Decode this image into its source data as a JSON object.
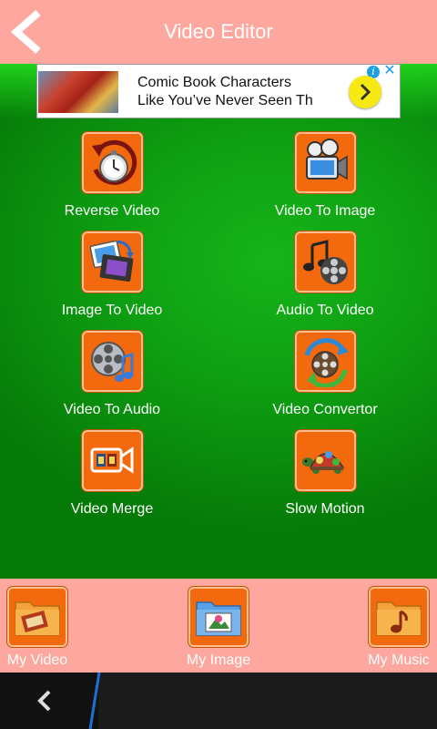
{
  "header": {
    "title": "Video Editor",
    "back_icon": "chevron-left-icon",
    "background": "#fda79f"
  },
  "ad": {
    "text": "Comic Book Characters\nLike You’ve Never Seen Th",
    "info_icon": "info-icon",
    "info_glyph": "i",
    "close_icon": "close-icon",
    "close_glyph": "✕",
    "arrow_icon": "chevron-right-icon"
  },
  "tools": [
    {
      "label": "Reverse Video",
      "icon": "stopwatch-icon"
    },
    {
      "label": "Video To Image",
      "icon": "film-projector-icon"
    },
    {
      "label": "Image To Video",
      "icon": "image-to-video-icon"
    },
    {
      "label": "Audio To Video",
      "icon": "music-film-reel-icon"
    },
    {
      "label": "Video To Audio",
      "icon": "film-reel-music-icon"
    },
    {
      "label": "Video Convertor",
      "icon": "reel-convert-icon"
    },
    {
      "label": "Video Merge",
      "icon": "video-merge-icon"
    },
    {
      "label": "Slow Motion",
      "icon": "turtle-icon"
    }
  ],
  "bottom": [
    {
      "label": "My Video",
      "icon": "video-folder-icon"
    },
    {
      "label": "My Image",
      "icon": "image-folder-icon"
    },
    {
      "label": "My Music",
      "icon": "music-folder-icon"
    }
  ],
  "colors": {
    "accent": "#f26a0d",
    "background": "#0e9f12",
    "panel": "#fda79f"
  }
}
